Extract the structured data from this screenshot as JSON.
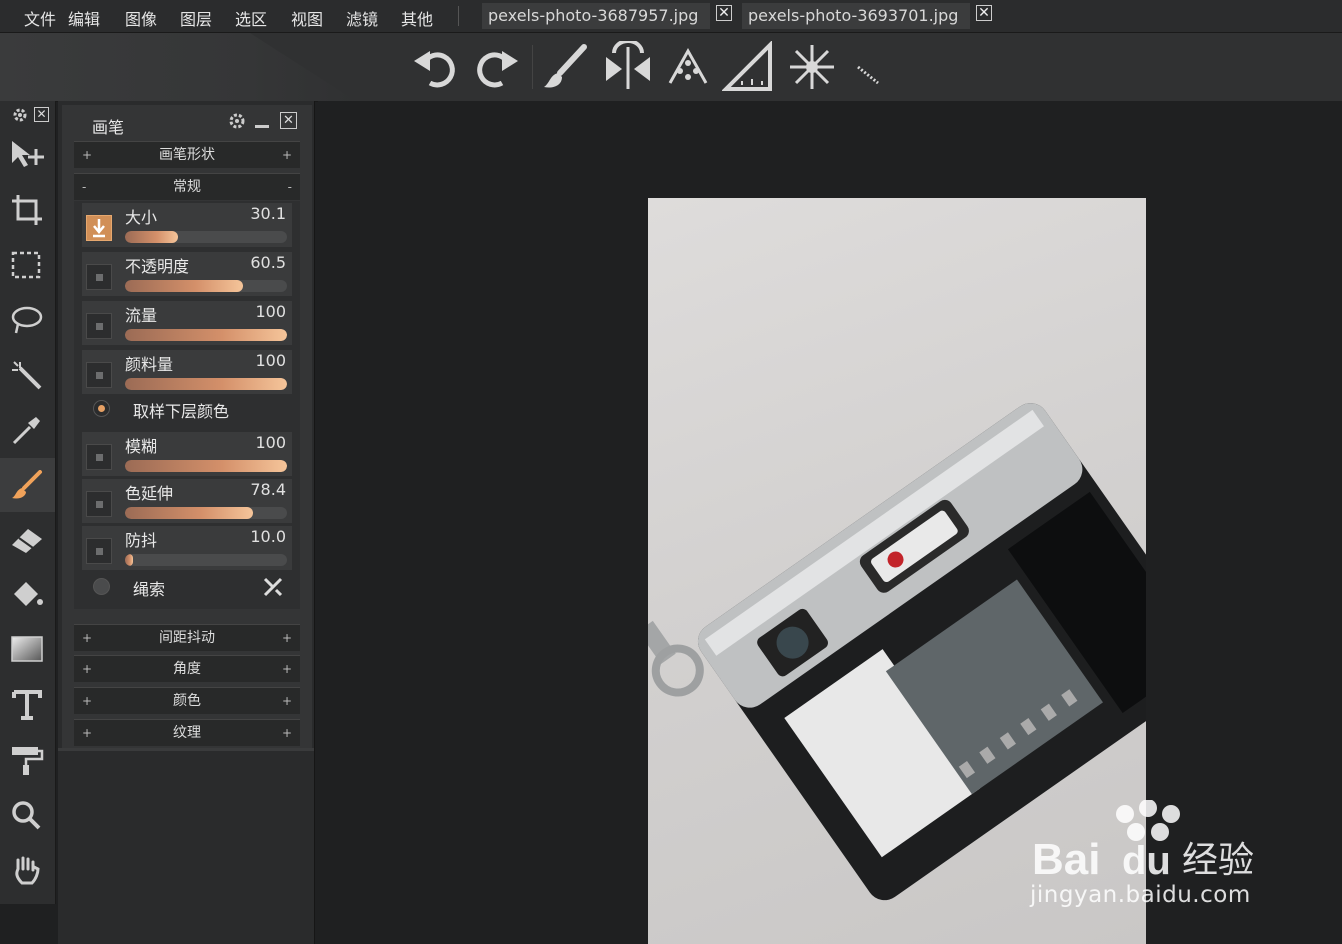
{
  "menu": [
    "文件",
    "编辑",
    "图像",
    "图层",
    "选区",
    "视图",
    "滤镜",
    "其他"
  ],
  "tabs": [
    {
      "label": "pexels-photo-3687957.jpg",
      "close": "✕"
    },
    {
      "label": "pexels-photo-3693701.jpg",
      "close": "✕"
    }
  ],
  "toolbar_icons": [
    "undo-icon",
    "redo-icon",
    "brush-icon",
    "symmetry-icon",
    "scatter-icon",
    "ruler-icon",
    "snowflake-icon",
    "dotted-line-icon"
  ],
  "tools": [
    "move-icon",
    "crop-icon",
    "marquee-icon",
    "lasso-icon",
    "magic-wand-icon",
    "eyedropper-icon",
    "brush-icon",
    "eraser-icon",
    "paint-bucket-icon",
    "gradient-icon",
    "text-icon",
    "paint-roller-icon",
    "zoom-icon",
    "hand-icon"
  ],
  "panel": {
    "title": "画笔",
    "sections_top": [
      {
        "label": "画笔形状",
        "left": "+",
        "right": "+"
      },
      {
        "label": "常规",
        "left": "-",
        "right": "-"
      }
    ],
    "rows": [
      {
        "label": "大小",
        "value": "30.1",
        "fill": 0.33,
        "checked": true
      },
      {
        "label": "不透明度",
        "value": "60.5",
        "fill": 0.73,
        "checked": false
      },
      {
        "label": "流量",
        "value": "100",
        "fill": 1.0,
        "checked": false
      },
      {
        "label": "颜料量",
        "value": "100",
        "fill": 1.0,
        "checked": false
      },
      {
        "label": "模糊",
        "value": "100",
        "fill": 1.0,
        "checked": false
      },
      {
        "label": "色延伸",
        "value": "78.4",
        "fill": 0.79,
        "checked": false
      },
      {
        "label": "防抖",
        "value": "10.0",
        "fill": 0.05,
        "checked": false
      }
    ],
    "sample_below": "取样下层颜色",
    "lasso": "绳索",
    "sections_bottom": [
      {
        "label": "间距抖动",
        "left": "+",
        "right": "+"
      },
      {
        "label": "角度",
        "left": "+",
        "right": "+"
      },
      {
        "label": "颜色",
        "left": "+",
        "right": "+"
      },
      {
        "label": "纹理",
        "left": "+",
        "right": "+"
      }
    ]
  },
  "watermark": {
    "text": "jingyan.baidu.com",
    "logo": "Bai du 经验"
  }
}
